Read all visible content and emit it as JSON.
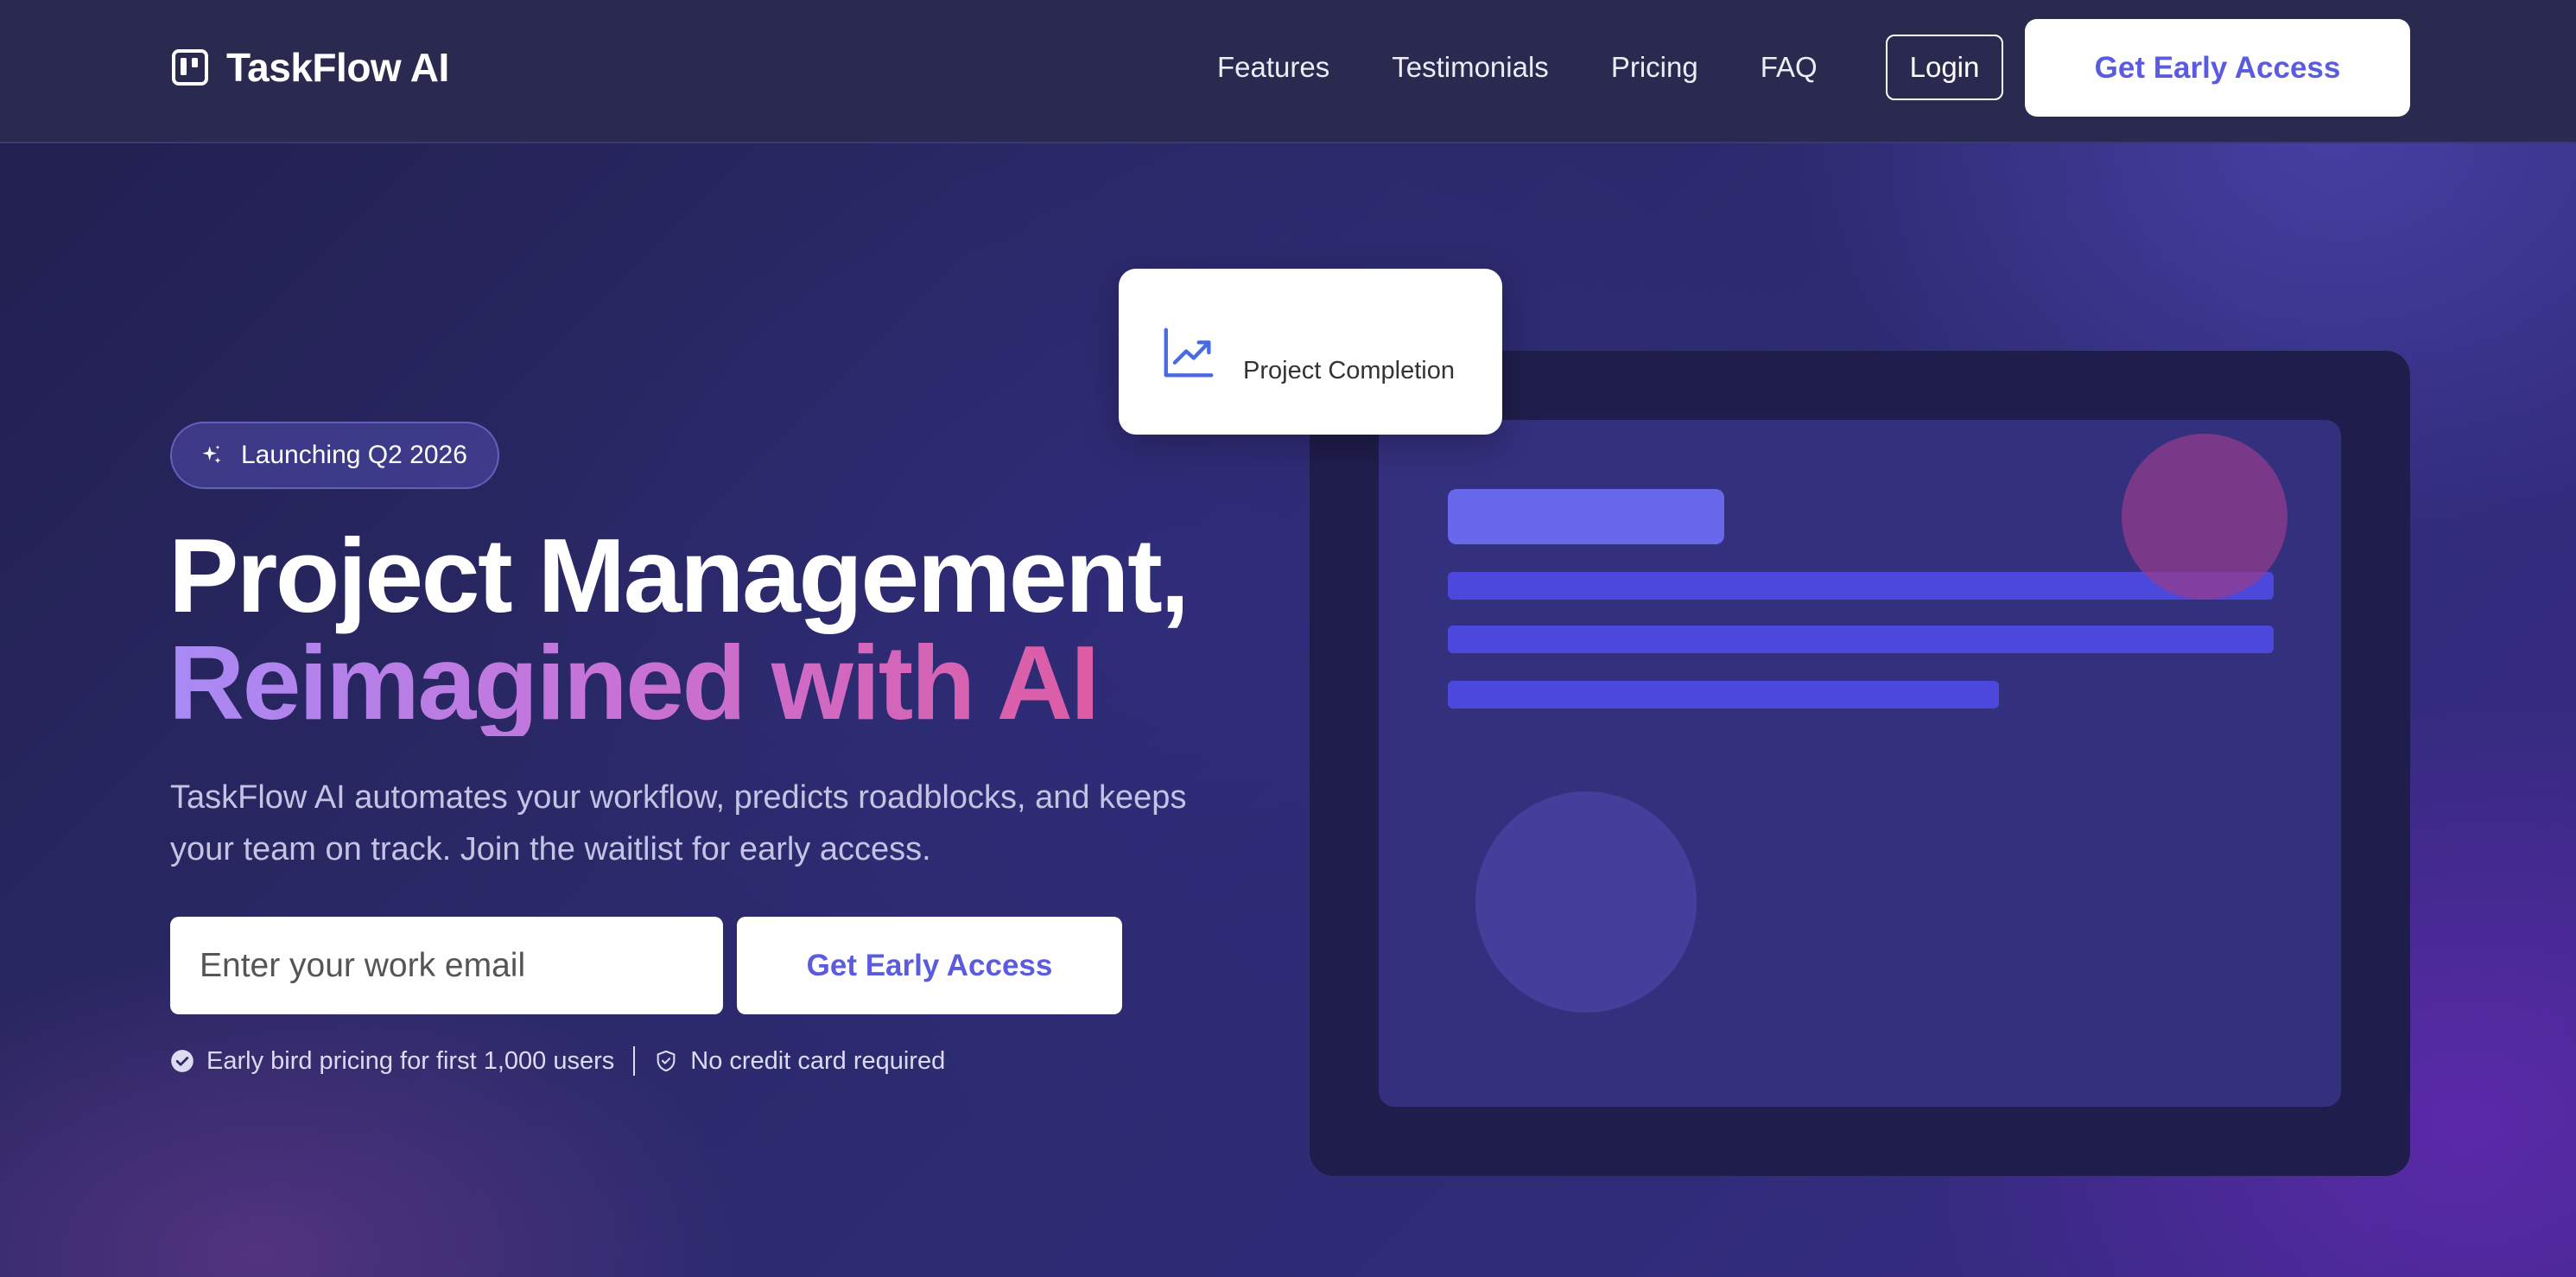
{
  "colors": {
    "accent": "#5b5be0",
    "nav_bg": "#2a2950",
    "gradient_start": "#a98af5",
    "gradient_end": "#e2589a"
  },
  "nav": {
    "brand": "TaskFlow AI",
    "brand_icon": "kanban-board-icon",
    "links": [
      "Features",
      "Testimonials",
      "Pricing",
      "FAQ"
    ],
    "login_label": "Login",
    "cta_label": "Get Early Access"
  },
  "hero": {
    "badge": {
      "icon": "sparkle-icon",
      "text": "Launching Q2 2026"
    },
    "headline_line1": "Project Management,",
    "headline_line2": "Reimagined with AI",
    "subtitle": "TaskFlow AI automates your workflow, predicts roadblocks, and keeps your team on track. Join the waitlist for early access.",
    "email_placeholder": "Enter your work email",
    "cta_label": "Get Early Access",
    "perks": [
      {
        "icon": "check-circle-icon",
        "text": "Early bird pricing for first 1,000 users"
      },
      {
        "icon": "shield-icon",
        "text": "No credit card required"
      }
    ]
  },
  "mockup": {
    "card": {
      "icon": "trending-up-chart-icon",
      "label": "Project Completion"
    }
  }
}
